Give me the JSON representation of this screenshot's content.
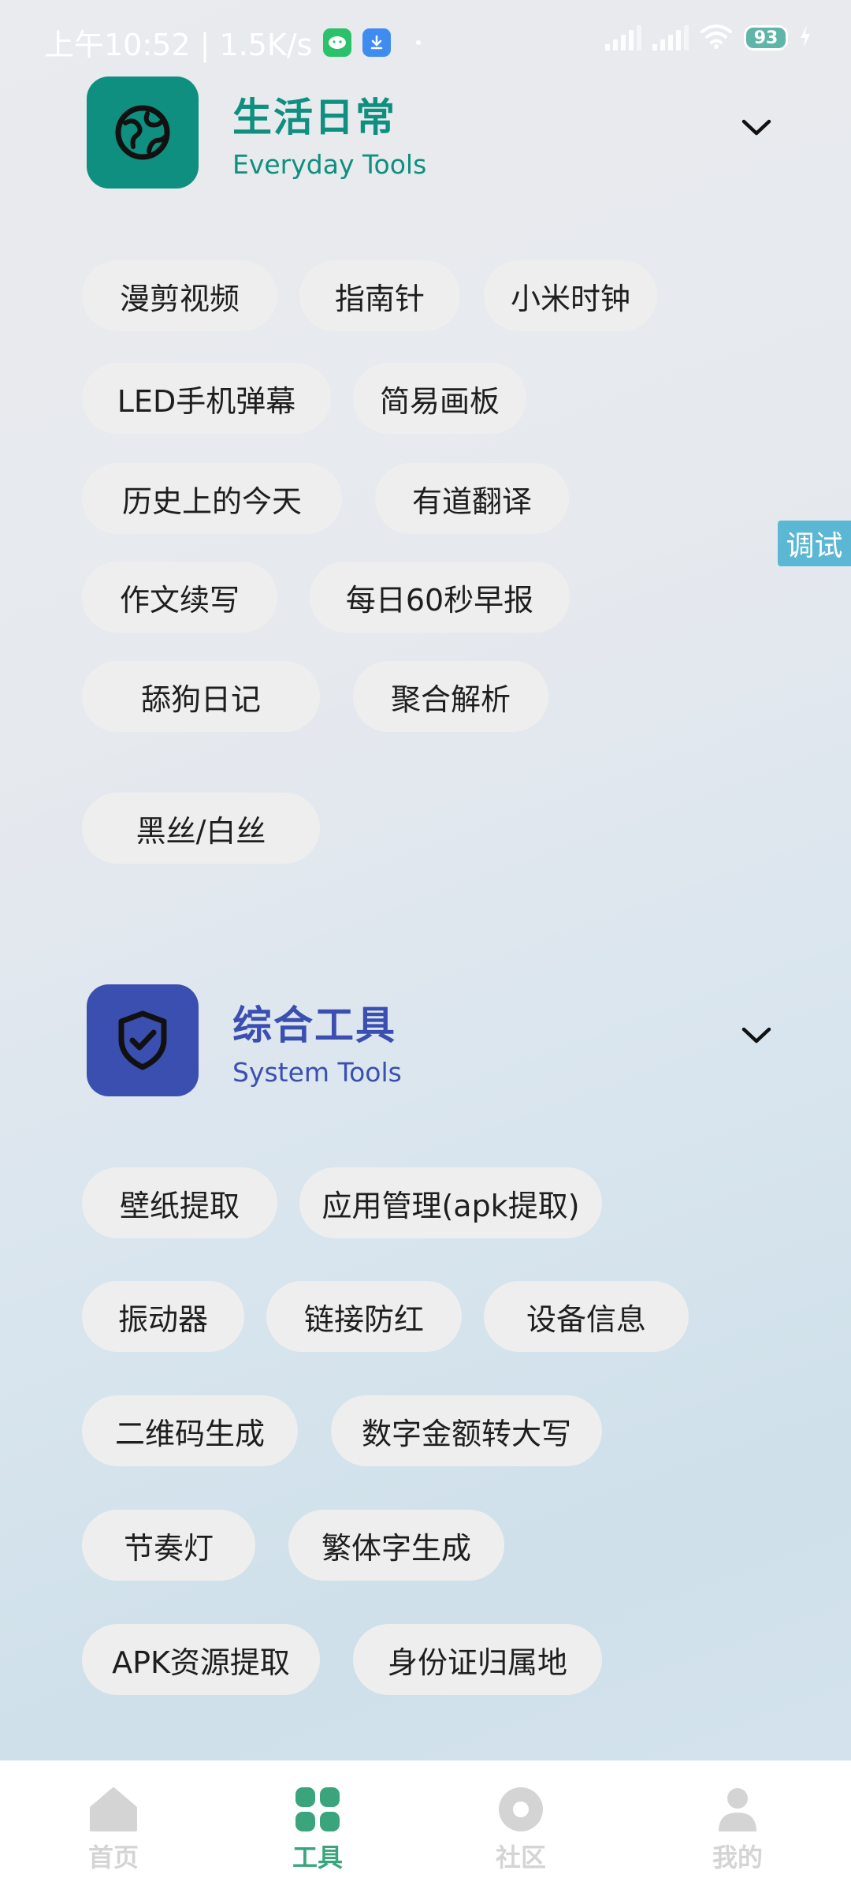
{
  "status_bar": {
    "time_speed": "上午10:52 | 1.5K/s",
    "battery": "93",
    "icons": [
      "wechat-icon",
      "download-icon",
      "signal-icon",
      "signal-icon",
      "wifi-icon",
      "charging-icon"
    ]
  },
  "sections": [
    {
      "title": "生活日常",
      "subtitle": "Everyday Tools",
      "icon": "globe-icon",
      "accent": "#0e8f7f",
      "chips": [
        "漫剪视频",
        "指南针",
        "小米时钟",
        "LED手机弹幕",
        "简易画板",
        "历史上的今天",
        "有道翻译",
        "作文续写",
        "每日60秒早报",
        "舔狗日记",
        "聚合解析",
        "黑丝/白丝"
      ]
    },
    {
      "title": "综合工具",
      "subtitle": "System Tools",
      "icon": "shield-check-icon",
      "accent": "#3b4fb0",
      "chips": [
        "壁纸提取",
        "应用管理(apk提取)",
        "振动器",
        "链接防红",
        "设备信息",
        "二维码生成",
        "数字金额转大写",
        "节奏灯",
        "繁体字生成",
        "APK资源提取",
        "身份证归属地"
      ]
    }
  ],
  "debug_label": "调试",
  "bottom_nav": {
    "active_color": "#3aa57c",
    "inactive_color": "#d4d4d4",
    "items": [
      {
        "label": "首页",
        "icon": "home-icon",
        "active": false
      },
      {
        "label": "工具",
        "icon": "grid-icon",
        "active": true
      },
      {
        "label": "社区",
        "icon": "community-icon",
        "active": false
      },
      {
        "label": "我的",
        "icon": "profile-icon",
        "active": false
      }
    ]
  }
}
